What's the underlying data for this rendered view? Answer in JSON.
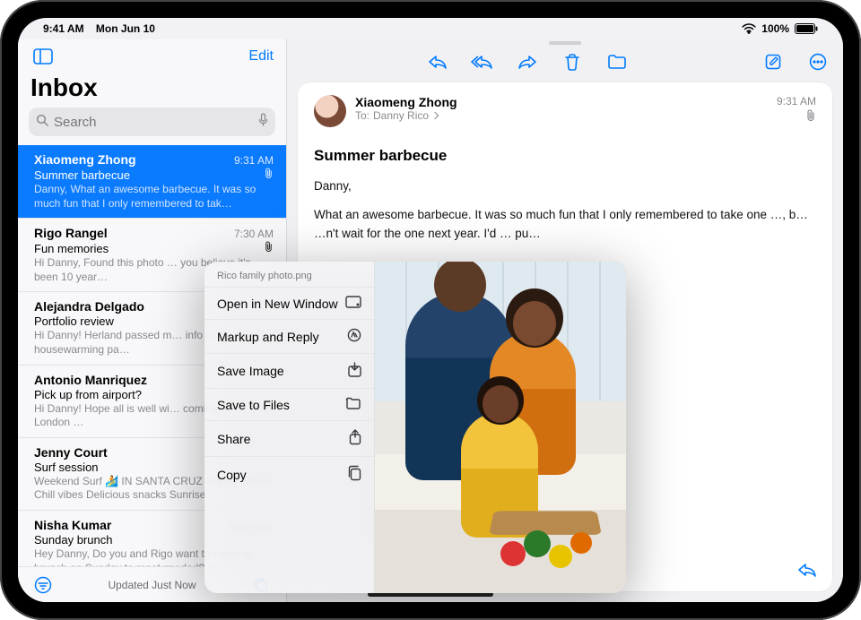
{
  "status": {
    "time": "9:41 AM",
    "date": "Mon Jun 10",
    "battery": "100%"
  },
  "sidebar": {
    "edit": "Edit",
    "title": "Inbox",
    "search_placeholder": "Search",
    "bottom_status": "Updated Just Now"
  },
  "messages": [
    {
      "sender": "Xiaomeng Zhong",
      "time": "9:31 AM",
      "subject": "Summer barbecue",
      "preview": "Danny, What an awesome barbecue. It was so much fun that I only remembered to tak…",
      "has_attachment": true,
      "selected": true
    },
    {
      "sender": "Rigo Rangel",
      "time": "7:30 AM",
      "subject": "Fun memories",
      "preview": "Hi Danny, Found this photo … you believe it's been 10 year…",
      "has_attachment": true,
      "selected": false
    },
    {
      "sender": "Alejandra Delgado",
      "time": "",
      "subject": "Portfolio review",
      "preview": "Hi Danny! Herland passed m… info at his housewarming pa…",
      "has_attachment": false,
      "selected": false
    },
    {
      "sender": "Antonio Manriquez",
      "time": "",
      "subject": "Pick up from airport?",
      "preview": "Hi Danny! Hope all is well wi… coming home from London …",
      "has_attachment": false,
      "selected": false
    },
    {
      "sender": "Jenny Court",
      "time": "",
      "subject": "Surf session",
      "preview": "Weekend Surf 🏄 IN SANTA CRUZ Glassy waves Chill vibes Delicious snacks Sunrise…",
      "has_attachment": false,
      "selected": false
    },
    {
      "sender": "Nisha Kumar",
      "time": "Yesterday",
      "subject": "Sunday brunch",
      "preview": "Hey Danny, Do you and Rigo want to come to brunch on Sunday to meet my dad? If y…",
      "has_attachment": false,
      "selected": false
    }
  ],
  "message": {
    "from": "Xiaomeng Zhong",
    "to_label": "To:",
    "to": "Danny Rico",
    "time": "9:31 AM",
    "subject": "Summer barbecue",
    "greeting": "Danny,",
    "body": "What an awesome barbecue. It was so much fun that I only remembered to take one …, b…                                                     …n't wait for the one next year. I'd … pu…"
  },
  "context_menu": {
    "filename": "Rico family photo.png",
    "items": [
      {
        "label": "Open in New Window",
        "icon": "window"
      },
      {
        "label": "Markup and Reply",
        "icon": "markup"
      },
      {
        "label": "Save Image",
        "icon": "save-image"
      },
      {
        "label": "Save to Files",
        "icon": "folder"
      },
      {
        "label": "Share",
        "icon": "share"
      },
      {
        "label": "Copy",
        "icon": "copy"
      }
    ]
  }
}
